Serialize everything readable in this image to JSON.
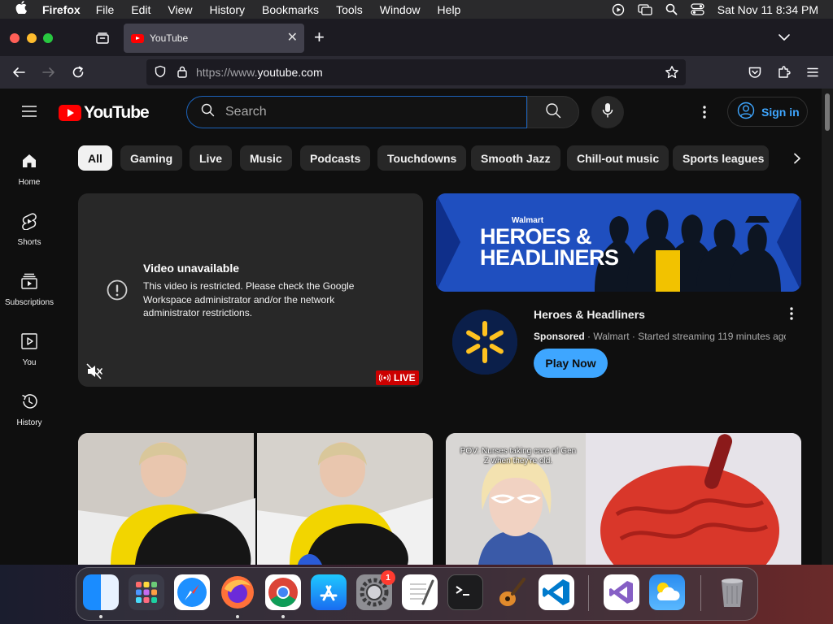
{
  "menubar": {
    "app_name": "Firefox",
    "menus": [
      "File",
      "Edit",
      "View",
      "History",
      "Bookmarks",
      "Tools",
      "Window",
      "Help"
    ],
    "clock": "Sat Nov 11  8:34 PM"
  },
  "browser": {
    "tab_title": "YouTube",
    "url_scheme": "https://www.",
    "url_host": "youtube.com"
  },
  "youtube": {
    "logo_text": "YouTube",
    "search_placeholder": "Search",
    "signin_label": "Sign in",
    "rail": [
      {
        "label": "Home",
        "icon": "home-icon"
      },
      {
        "label": "Shorts",
        "icon": "shorts-icon"
      },
      {
        "label": "Subscriptions",
        "icon": "subscriptions-icon"
      },
      {
        "label": "You",
        "icon": "you-icon"
      },
      {
        "label": "History",
        "icon": "history-icon"
      }
    ],
    "chips": [
      "All",
      "Gaming",
      "Live",
      "Music",
      "Podcasts",
      "Touchdowns",
      "Smooth Jazz",
      "Chill-out music",
      "Sports leagues"
    ],
    "player": {
      "error_title": "Video unavailable",
      "error_message": "This video is restricted. Please check the Google Workspace administrator and/or the network administrator restrictions.",
      "live_label": "LIVE"
    },
    "ad": {
      "brand": "Walmart",
      "headline_line1": "HEROES &",
      "headline_line2": "HEADLINERS",
      "title": "Heroes & Headliners",
      "sponsored": "Sponsored",
      "meta": " · Walmart · Started streaming 119 minutes ago",
      "cta": "Play Now"
    },
    "thumb2_caption": "POV: Nurses taking care of Gen Z when they're old."
  },
  "dock": {
    "apps": [
      "Finder",
      "Launchpad",
      "Safari",
      "Firefox",
      "Chrome",
      "App Store",
      "System Settings",
      "TextEdit",
      "Terminal",
      "GarageBand",
      "Visual Studio Code",
      "Visual Studio",
      "Weather",
      "Trash"
    ],
    "settings_badge": "1"
  }
}
